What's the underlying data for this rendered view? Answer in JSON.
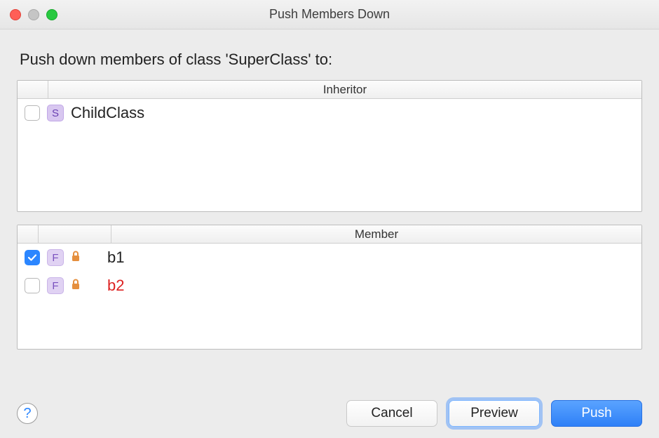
{
  "window": {
    "title": "Push Members Down"
  },
  "prompt": "Push down members of class 'SuperClass' to:",
  "inheritor": {
    "header": "Inheritor",
    "rows": [
      {
        "checked": false,
        "badge": "S",
        "name": "ChildClass"
      }
    ]
  },
  "member": {
    "header": "Member",
    "rows": [
      {
        "checked": true,
        "badge": "F",
        "name": "b1",
        "red": false
      },
      {
        "checked": false,
        "badge": "F",
        "name": "b2",
        "red": true
      }
    ]
  },
  "buttons": {
    "cancel": "Cancel",
    "preview": "Preview",
    "push": "Push"
  }
}
